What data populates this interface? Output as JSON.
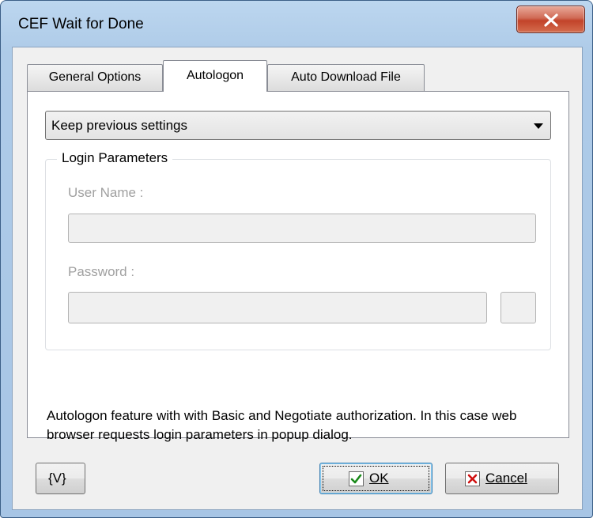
{
  "window": {
    "title": "CEF Wait for Done"
  },
  "tabs": [
    {
      "label": "General Options",
      "active": false
    },
    {
      "label": "Autologon",
      "active": true
    },
    {
      "label": "Auto Download File",
      "active": false
    }
  ],
  "autologon": {
    "mode_selected": "Keep previous settings",
    "group_title": "Login Parameters",
    "user_name_label": "User Name :",
    "user_name_value": "",
    "password_label": "Password :",
    "password_value": "",
    "description": "Autologon feature with with Basic and Negotiate authorization. In this case web browser requests login parameters in popup dialog."
  },
  "footer": {
    "variables_label": "{V}",
    "ok_label": "OK",
    "cancel_label": "Cancel"
  },
  "icons": {
    "close": "close-icon",
    "ok": "checkmark-icon",
    "cancel": "x-icon",
    "dropdown": "chevron-down-icon"
  },
  "colors": {
    "ok_check": "#1a8a1a",
    "cancel_x": "#d01010",
    "close_button": "#c2432a"
  }
}
